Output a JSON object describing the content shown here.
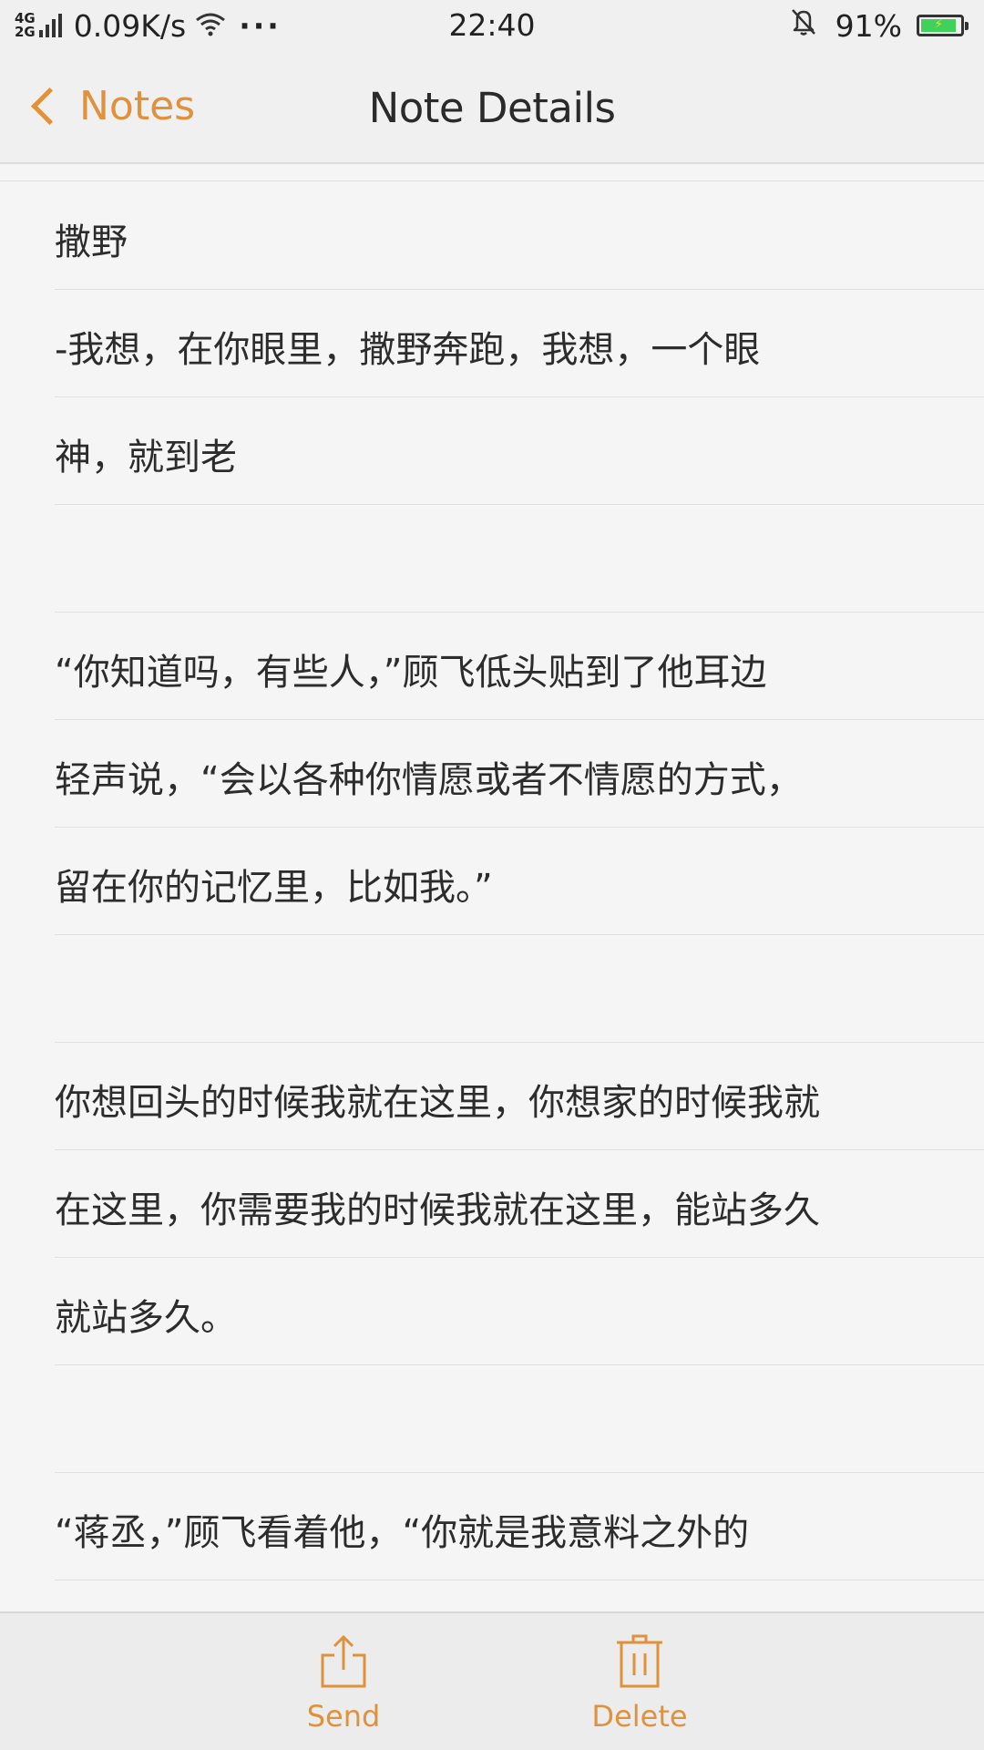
{
  "status_bar": {
    "net_type_top": "4G",
    "net_type_bottom": "2G",
    "net_speed": "0.09K/s",
    "more": "···",
    "time": "22:40",
    "battery_percent": "91%",
    "battery_level": 0.91,
    "icons": [
      "signal-icon",
      "wifi-icon",
      "bell-muted-icon",
      "battery-charging-icon"
    ]
  },
  "nav": {
    "back_label": "Notes",
    "title": "Note Details"
  },
  "note": {
    "lines": [
      "撒野",
      "-我想，在你眼里，撒野奔跑，我想，一个眼",
      "神，就到老",
      "",
      "“你知道吗，有些人，”顾飞低头贴到了他耳边",
      "轻声说，“会以各种你情愿或者不情愿的方式，",
      "留在你的记忆里，比如我。”",
      "",
      "你想回头的时候我就在这里，你想家的时候我就",
      "在这里，你需要我的时候我就在这里，能站多久",
      "就站多久。",
      "",
      "“蒋丞，”顾飞看着他，“你就是我意料之外的"
    ]
  },
  "toolbar": {
    "send_label": "Send",
    "delete_label": "Delete"
  },
  "colors": {
    "accent": "#e0913c",
    "background": "#f5f5f5",
    "bar": "#f0f0f0",
    "text": "#2c2c2c",
    "rule": "#e0e0e0",
    "battery": "#3fd15a"
  }
}
